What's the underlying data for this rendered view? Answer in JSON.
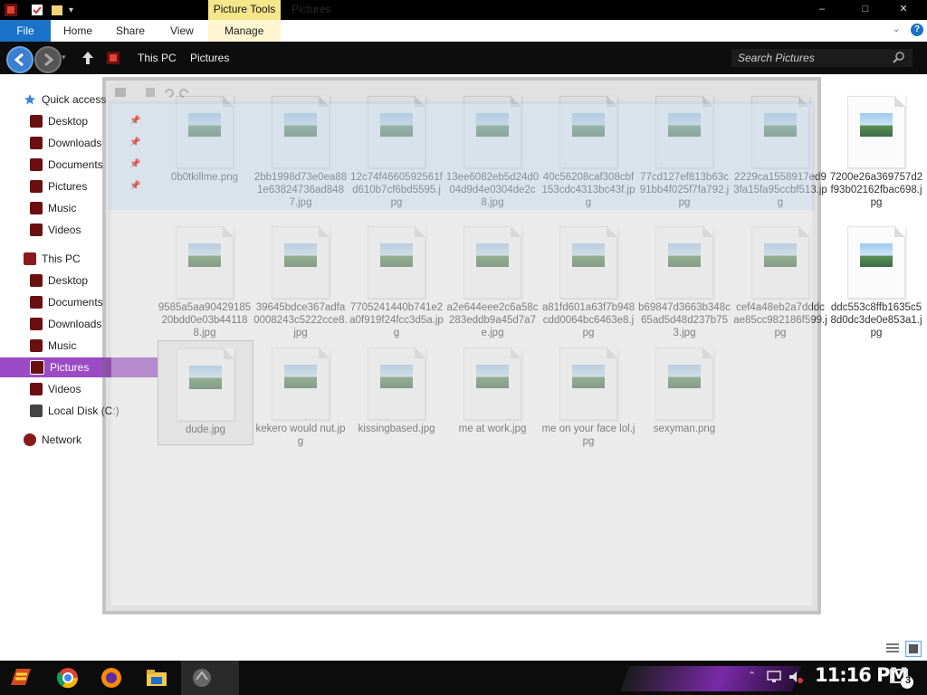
{
  "window": {
    "title": "Pictures",
    "context_tab": "Picture Tools",
    "controls": [
      "–",
      "□",
      "✕"
    ]
  },
  "ribbon": {
    "tabs": [
      "File",
      "Home",
      "Share",
      "View",
      "Manage"
    ]
  },
  "address": {
    "crumbs": [
      "This PC",
      "Pictures"
    ],
    "search_placeholder": "Search Pictures"
  },
  "sidebar": {
    "quick_access": "Quick access",
    "quick_items": [
      "Desktop",
      "Downloads",
      "Documents",
      "Pictures",
      "Music",
      "Videos"
    ],
    "this_pc": "This PC",
    "pc_items": [
      "Desktop",
      "Documents",
      "Downloads",
      "Music",
      "Pictures",
      "Videos",
      "Local Disk (C:)"
    ],
    "network": "Network",
    "selected": "Pictures"
  },
  "files": [
    {
      "name": "0b0tkillme.png"
    },
    {
      "name": "2bb1998d73e0ea881e63824736ad8487.jpg"
    },
    {
      "name": "12c74f4660592561fd610b7cf6bd5595.jpg"
    },
    {
      "name": "13ee6082eb5d24d004d9d4e0304de2c8.jpg"
    },
    {
      "name": "40c56208caf308cbf153cdc4313bc43f.jpg"
    },
    {
      "name": "77cd127ef813b63c91bb4f025f7fa792.jpg"
    },
    {
      "name": "2229ca1558917ed93fa15fa95ccbf513.jpg"
    },
    {
      "name": "7200e26a369757d2f93b02162fbac698.jpg"
    },
    {
      "name": "9585a5aa9042918520bdd0e03b441188.jpg"
    },
    {
      "name": "39645bdce367adfa0008243c5222cce8.jpg"
    },
    {
      "name": "7705241440b741e2a0f919f24fcc3d5a.jpg"
    },
    {
      "name": "a2e644eee2c6a58c283eddb9a45d7a7e.jpg"
    },
    {
      "name": "a81fd601a63f7b948cdd0064bc6463e8.jpg"
    },
    {
      "name": "b69847d3663b348c65ad5d48d237b753.jpg"
    },
    {
      "name": "cef4a48eb2a7dddcae85cc982186f599.jpg"
    },
    {
      "name": "ddc553c8ffb1635c58d0dc3de0e853a1.jpg"
    },
    {
      "name": "dude.jpg"
    },
    {
      "name": "kekero would nut.jpg"
    },
    {
      "name": "kissingbased.jpg"
    },
    {
      "name": "me at work.jpg"
    },
    {
      "name": "me on your face lol.jpg"
    },
    {
      "name": "sexyman.png"
    }
  ],
  "taskbar": {
    "time": "11:16 PM",
    "notification_count": "3"
  },
  "colors": {
    "file_tab": "#1a73c9",
    "accent_purple": "#9b4bc6",
    "picture_tools": "#f6e68a"
  }
}
